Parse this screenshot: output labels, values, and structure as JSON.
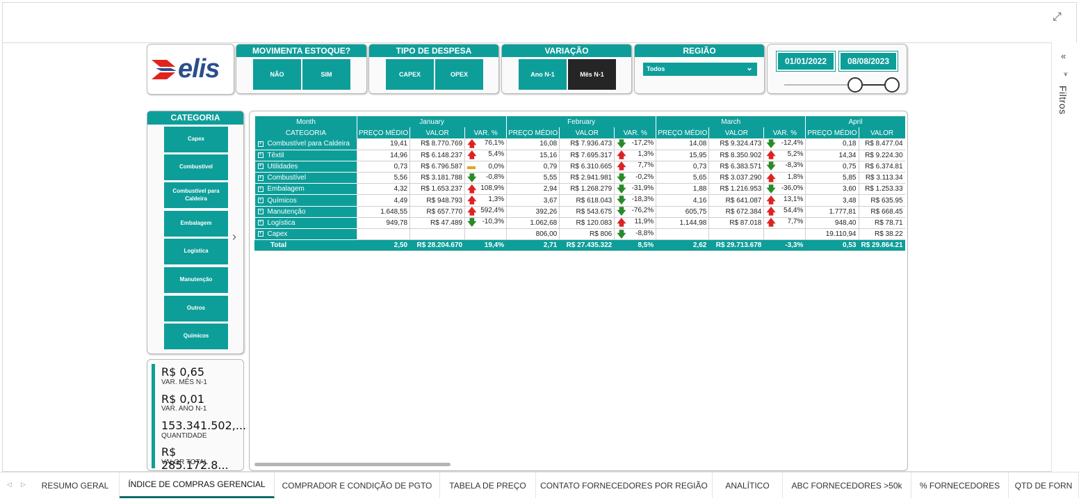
{
  "colors": {
    "accent": "#0e9e9a",
    "dark": "#252525",
    "up": "#dd2222",
    "down": "#2a8a2a",
    "flat": "#e7a21f"
  },
  "logo": {
    "text": "elis"
  },
  "filters_pane": {
    "label": "Filtros"
  },
  "slicers": {
    "movimenta": {
      "title": "MOVIMENTA ESTOQUE?",
      "options": [
        "NÃO",
        "SIM"
      ]
    },
    "tipo": {
      "title": "TIPO DE DESPESA",
      "options": [
        "CAPEX",
        "OPEX"
      ]
    },
    "variacao": {
      "title": "VARIAÇÃO",
      "options": [
        "Ano N-1",
        "Mês N-1"
      ],
      "selected": "Mês N-1"
    },
    "regiao": {
      "title": "REGIÃO",
      "value": "Todos"
    },
    "datas": {
      "start": "01/01/2022",
      "end": "08/08/2023"
    }
  },
  "categoria": {
    "title": "CATEGORIA",
    "items": [
      "Capex",
      "Combustível",
      "Combustível para Caldeira",
      "Embalagem",
      "Logística",
      "Manutenção",
      "Outros",
      "Químicos"
    ]
  },
  "kpis": [
    {
      "value": "R$ 0,65",
      "label": "VAR. MÊS N-1"
    },
    {
      "value": "R$ 0,01",
      "label": "VAR. ANO N-1"
    },
    {
      "value": "153.341.502,...",
      "label": "QUANTIDADE"
    },
    {
      "value": "R$ 285.172.8...",
      "label": "VALOR TOTAL"
    }
  ],
  "table": {
    "month_header": "Month",
    "category_header": "CATEGORIA",
    "months": [
      "January",
      "February",
      "March",
      "April"
    ],
    "sub_headers": [
      "PREÇO MÉDIO",
      "VALOR",
      "VAR. %"
    ],
    "rows": [
      {
        "cat": "Combustível para Caldeira",
        "m": [
          [
            "19,41",
            "R$ 8.770.769",
            "up",
            "76,1%"
          ],
          [
            "16,08",
            "R$ 7.936.473",
            "down",
            "-17,2%"
          ],
          [
            "14,08",
            "R$ 9.324.473",
            "down",
            "-12,4%"
          ],
          [
            "0,18",
            "R$ 8.477.04"
          ]
        ]
      },
      {
        "cat": "Têxtil",
        "m": [
          [
            "14,96",
            "R$ 6.148.237",
            "up",
            "5,4%"
          ],
          [
            "15,16",
            "R$ 7.695.317",
            "up",
            "1,3%"
          ],
          [
            "15,95",
            "R$ 8.350.902",
            "up",
            "5,2%"
          ],
          [
            "14,34",
            "R$ 9.224.30"
          ]
        ]
      },
      {
        "cat": "Utilidades",
        "m": [
          [
            "0,73",
            "R$ 6.796.587",
            "flat",
            "0,0%"
          ],
          [
            "0,79",
            "R$ 6.310.665",
            "up",
            "7,7%"
          ],
          [
            "0,73",
            "R$ 6.383.571",
            "down",
            "-8,3%"
          ],
          [
            "0,75",
            "R$ 6.374.81"
          ]
        ]
      },
      {
        "cat": "Combustível",
        "m": [
          [
            "5,56",
            "R$ 3.181.788",
            "down",
            "-0,8%"
          ],
          [
            "5,55",
            "R$ 2.941.981",
            "down",
            "-0,2%"
          ],
          [
            "5,65",
            "R$ 3.037.290",
            "up",
            "1,8%"
          ],
          [
            "5,85",
            "R$ 3.113.34"
          ]
        ]
      },
      {
        "cat": "Embalagem",
        "m": [
          [
            "4,32",
            "R$ 1.653.237",
            "up",
            "108,9%"
          ],
          [
            "2,94",
            "R$ 1.268.279",
            "down",
            "-31,9%"
          ],
          [
            "1,88",
            "R$ 1.216.953",
            "down",
            "-36,0%"
          ],
          [
            "3,60",
            "R$ 1.253.33"
          ]
        ]
      },
      {
        "cat": "Químicos",
        "m": [
          [
            "4,49",
            "R$ 948.793",
            "up",
            "1,3%"
          ],
          [
            "3,67",
            "R$ 618.043",
            "down",
            "-18,3%"
          ],
          [
            "4,16",
            "R$ 641.087",
            "up",
            "13,1%"
          ],
          [
            "3,48",
            "R$ 635.95"
          ]
        ]
      },
      {
        "cat": "Manutenção",
        "m": [
          [
            "1.648,55",
            "R$ 657.770",
            "up",
            "592,4%"
          ],
          [
            "392,26",
            "R$ 543.675",
            "down",
            "-76,2%"
          ],
          [
            "605,75",
            "R$ 672.384",
            "up",
            "54,4%"
          ],
          [
            "1.777,81",
            "R$ 668.45"
          ]
        ]
      },
      {
        "cat": "Logística",
        "m": [
          [
            "949,78",
            "R$ 47.489",
            "down",
            "-10,3%"
          ],
          [
            "1.062,68",
            "R$ 120.083",
            "up",
            "11,9%"
          ],
          [
            "1.144,98",
            "R$ 87.018",
            "up",
            "7,7%"
          ],
          [
            "948,40",
            "R$ 78.71"
          ]
        ]
      },
      {
        "cat": "Capex",
        "m": [
          [
            "",
            "",
            "",
            ""
          ],
          [
            "806,00",
            "R$ 806",
            "down",
            "-8,8%"
          ],
          [
            "",
            "",
            "",
            ""
          ],
          [
            "19.110,94",
            "R$ 38.22"
          ]
        ]
      }
    ],
    "total": {
      "label": "Total",
      "m": [
        [
          "2,50",
          "R$ 28.204.670",
          "19,4%"
        ],
        [
          "2,71",
          "R$ 27.435.322",
          "8,5%"
        ],
        [
          "2,62",
          "R$ 29.713.678",
          "-3,3%"
        ],
        [
          "0,53",
          "R$ 29.864.21"
        ]
      ]
    }
  },
  "tabs": [
    "RESUMO GERAL",
    "ÍNDICE DE COMPRAS GERENCIAL",
    "COMPRADOR E CONDIÇÃO DE PGTO",
    "TABELA DE PREÇO",
    "CONTATO FORNECEDORES POR REGIÃO",
    "ANALÍTICO",
    "ABC FORNECEDORES >50k",
    "% FORNECEDORES",
    "QTD DE FORN"
  ],
  "active_tab": "ÍNDICE DE COMPRAS GERENCIAL"
}
